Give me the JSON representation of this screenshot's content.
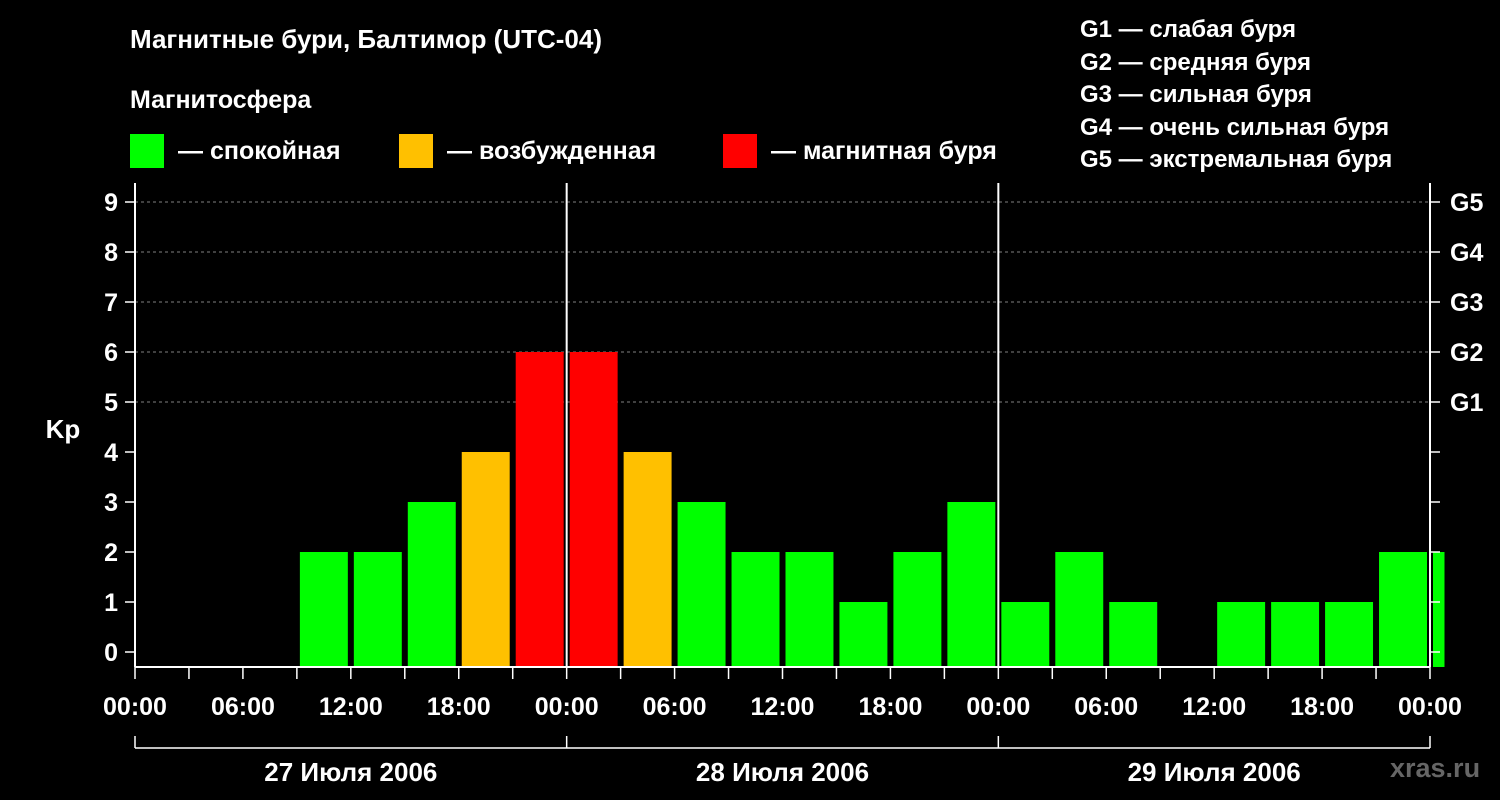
{
  "chart_data": {
    "type": "bar",
    "title": "Магнитные бури, Балтимор (UTC-04)",
    "subtitle": "Магнитосфера",
    "ylabel": "Kp",
    "ylim": [
      0,
      9
    ],
    "yticks": [
      "0",
      "1",
      "2",
      "3",
      "4",
      "5",
      "6",
      "7",
      "8",
      "9"
    ],
    "storm_levels": [
      {
        "label": "G1",
        "kp": 5
      },
      {
        "label": "G2",
        "kp": 6
      },
      {
        "label": "G3",
        "kp": 7
      },
      {
        "label": "G4",
        "kp": 8
      },
      {
        "label": "G5",
        "kp": 9
      }
    ],
    "status_legend": [
      {
        "key": "quiet",
        "label": "— спокойная",
        "color": "#00ff00"
      },
      {
        "key": "active",
        "label": "— возбужденная",
        "color": "#ffc000"
      },
      {
        "key": "storm",
        "label": "— магнитная буря",
        "color": "#ff0000"
      }
    ],
    "storm_legend": [
      "G1 — слабая буря",
      "G2 — средняя буря",
      "G3 — сильная буря",
      "G4 — очень сильная буря",
      "G5 — экстремальная буря"
    ],
    "xtick_labels": [
      "00:00",
      "06:00",
      "12:00",
      "18:00",
      "00:00",
      "06:00",
      "12:00",
      "18:00",
      "00:00",
      "06:00",
      "12:00",
      "18:00",
      "00:00"
    ],
    "days": [
      "27 Июля 2006",
      "28 Июля 2006",
      "29 Июля 2006"
    ],
    "interval_hours": 3,
    "values": [
      0,
      0,
      0,
      2,
      2,
      3,
      4,
      6,
      6,
      4,
      3,
      2,
      2,
      1,
      2,
      3,
      1,
      2,
      1,
      0,
      1,
      1,
      1,
      2,
      2
    ],
    "last_bar_fraction": 0.25,
    "watermark": "xras.ru"
  }
}
